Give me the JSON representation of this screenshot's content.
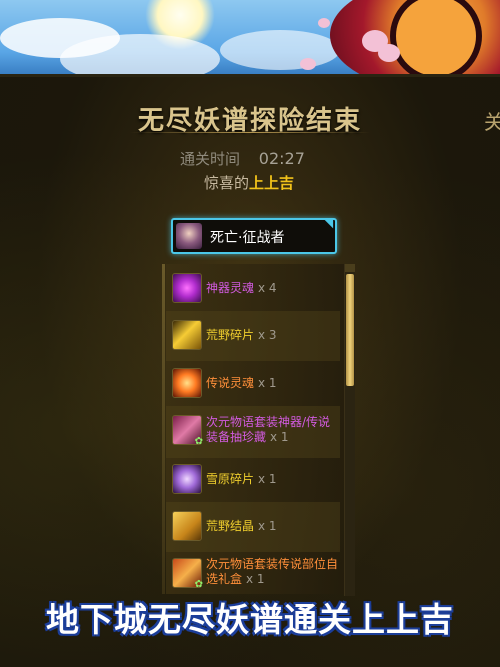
{
  "screen": {
    "title": "无尽妖谱探险结束",
    "title_side_fragment": "关",
    "clear_time_label": "通关时间",
    "clear_time_value": "02:27",
    "result_prefix": "惊喜的",
    "result_highlight": "上上吉"
  },
  "character": {
    "name": "死亡·征战者"
  },
  "rewards": [
    {
      "name": "神器灵魂",
      "qty": "x 4",
      "rarity": "mythic",
      "icon": "purple-soul-icon"
    },
    {
      "name": "荒野碎片",
      "qty": "x 3",
      "rarity": "epic",
      "icon": "wild-fragment-icon"
    },
    {
      "name": "传说灵魂",
      "qty": "x 1",
      "rarity": "legendary",
      "icon": "legendary-soul-icon"
    },
    {
      "name": "次元物语套装神器/传说装备抽珍藏",
      "qty": "x 1",
      "rarity": "mythic",
      "icon": "dimension-box-icon"
    },
    {
      "name": "雪原碎片",
      "qty": "x 1",
      "rarity": "epic",
      "icon": "snowfield-fragment-icon"
    },
    {
      "name": "荒野结晶",
      "qty": "x 1",
      "rarity": "epic",
      "icon": "wild-crystal-icon"
    },
    {
      "name": "次元物语套装传说部位自选礼盒",
      "qty": "x 1",
      "rarity": "legendary",
      "icon": "gift-chest-icon"
    }
  ],
  "caption": "地下城无尽妖谱通关上上吉",
  "colors": {
    "mythic": "#d25be0",
    "legendary": "#ff8f3a",
    "epic": "#f0cf2e",
    "name_box_border": "#4bc7e8",
    "caption_outline": "#1c3e9a"
  }
}
